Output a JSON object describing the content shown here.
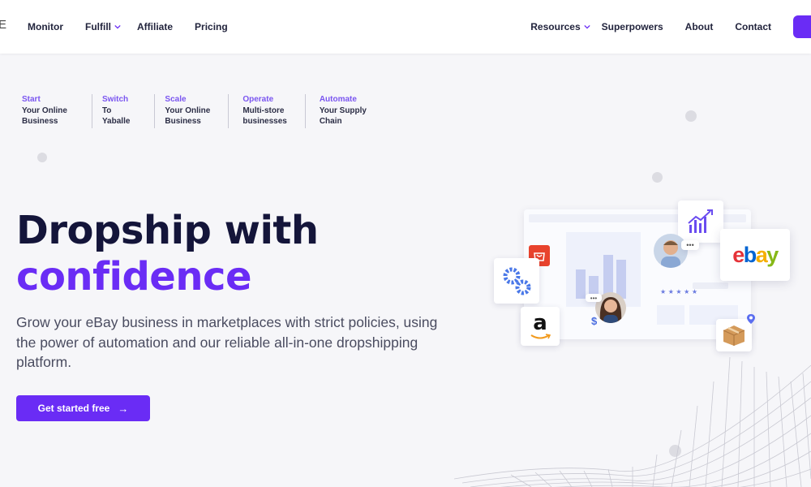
{
  "header": {
    "logo_fragment": "E",
    "nav_left": [
      {
        "label": "Monitor",
        "dropdown": false
      },
      {
        "label": "Fulfill",
        "dropdown": true
      },
      {
        "label": "Affiliate",
        "dropdown": false
      },
      {
        "label": "Pricing",
        "dropdown": false
      }
    ],
    "nav_right": [
      {
        "label": "Resources",
        "dropdown": true
      },
      {
        "label": "Superpowers",
        "dropdown": false
      },
      {
        "label": "About",
        "dropdown": false
      },
      {
        "label": "Contact",
        "dropdown": false
      }
    ]
  },
  "steps": [
    {
      "accent": "Start",
      "line1": "Your Online",
      "line2": "Business"
    },
    {
      "accent": "Switch",
      "line1": "To",
      "line2": "Yaballe"
    },
    {
      "accent": "Scale",
      "line1": "Your Online",
      "line2": "Business"
    },
    {
      "accent": "Operate",
      "line1": "Multi-store",
      "line2": "businesses"
    },
    {
      "accent": "Automate",
      "line1": "Your Supply",
      "line2": "Chain"
    }
  ],
  "hero": {
    "title_line1": "Dropship with",
    "title_line2": "confidence",
    "subtitle": "Grow your eBay business in marketplaces with strict policies, using the power of automation and our reliable all-in-one dropshipping platform.",
    "cta_label": "Get started free",
    "cta_arrow": "→"
  },
  "illustration": {
    "ebay_logo": "ebay",
    "amazon_logo": "a",
    "rating_stars": "★ ★ ★ ★ ★",
    "dollar": "$",
    "icons": [
      "chart-icon",
      "gears-icon",
      "aliexpress-icon",
      "amazon-icon",
      "package-icon",
      "location-pin-icon"
    ]
  },
  "colors": {
    "accent": "#6a2cf5",
    "title_dark": "#14153a",
    "background": "#f6f6f9",
    "step_accent": "#7a55f0"
  }
}
